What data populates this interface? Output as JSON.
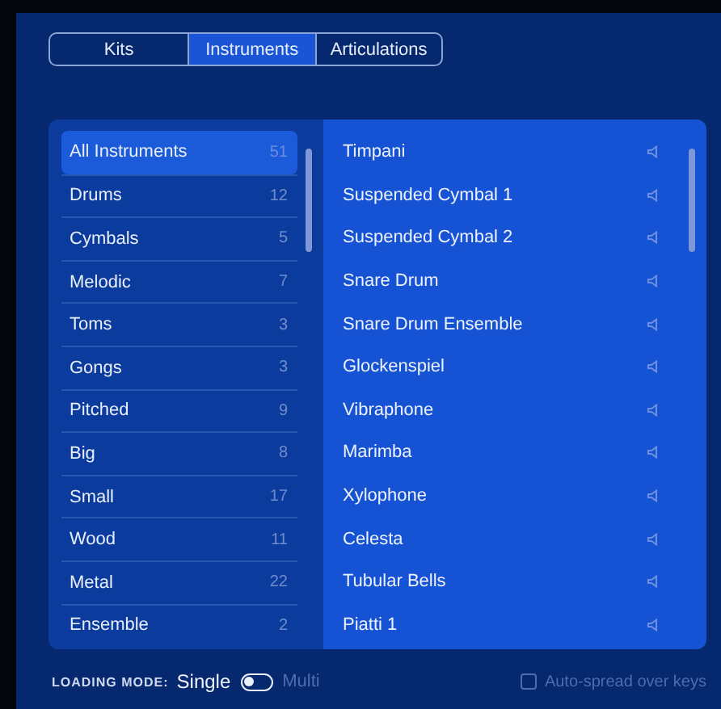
{
  "tabs": [
    {
      "label": "Kits",
      "selected": false
    },
    {
      "label": "Instruments",
      "selected": true
    },
    {
      "label": "Articulations",
      "selected": false
    }
  ],
  "categories": [
    {
      "label": "All Instruments",
      "count": "51",
      "selected": true
    },
    {
      "label": "Drums",
      "count": "12",
      "selected": false
    },
    {
      "label": "Cymbals",
      "count": "5",
      "selected": false
    },
    {
      "label": "Melodic",
      "count": "7",
      "selected": false
    },
    {
      "label": "Toms",
      "count": "3",
      "selected": false
    },
    {
      "label": "Gongs",
      "count": "3",
      "selected": false
    },
    {
      "label": "Pitched",
      "count": "9",
      "selected": false
    },
    {
      "label": "Big",
      "count": "8",
      "selected": false
    },
    {
      "label": "Small",
      "count": "17",
      "selected": false
    },
    {
      "label": "Wood",
      "count": "11",
      "selected": false
    },
    {
      "label": "Metal",
      "count": "22",
      "selected": false
    },
    {
      "label": "Ensemble",
      "count": "2",
      "selected": false
    }
  ],
  "instruments": [
    {
      "label": "Timpani"
    },
    {
      "label": "Suspended Cymbal 1"
    },
    {
      "label": "Suspended Cymbal 2"
    },
    {
      "label": "Snare Drum"
    },
    {
      "label": "Snare Drum Ensemble"
    },
    {
      "label": "Glockenspiel"
    },
    {
      "label": "Vibraphone"
    },
    {
      "label": "Marimba"
    },
    {
      "label": "Xylophone"
    },
    {
      "label": "Celesta"
    },
    {
      "label": "Tubular Bells"
    },
    {
      "label": "Piatti 1"
    }
  ],
  "loading_mode": {
    "label": "LOADING MODE:",
    "options": [
      {
        "label": "Single",
        "selected": true
      },
      {
        "label": "Multi",
        "selected": false
      }
    ]
  },
  "auto_spread": {
    "label": "Auto-spread over keys",
    "checked": false
  }
}
